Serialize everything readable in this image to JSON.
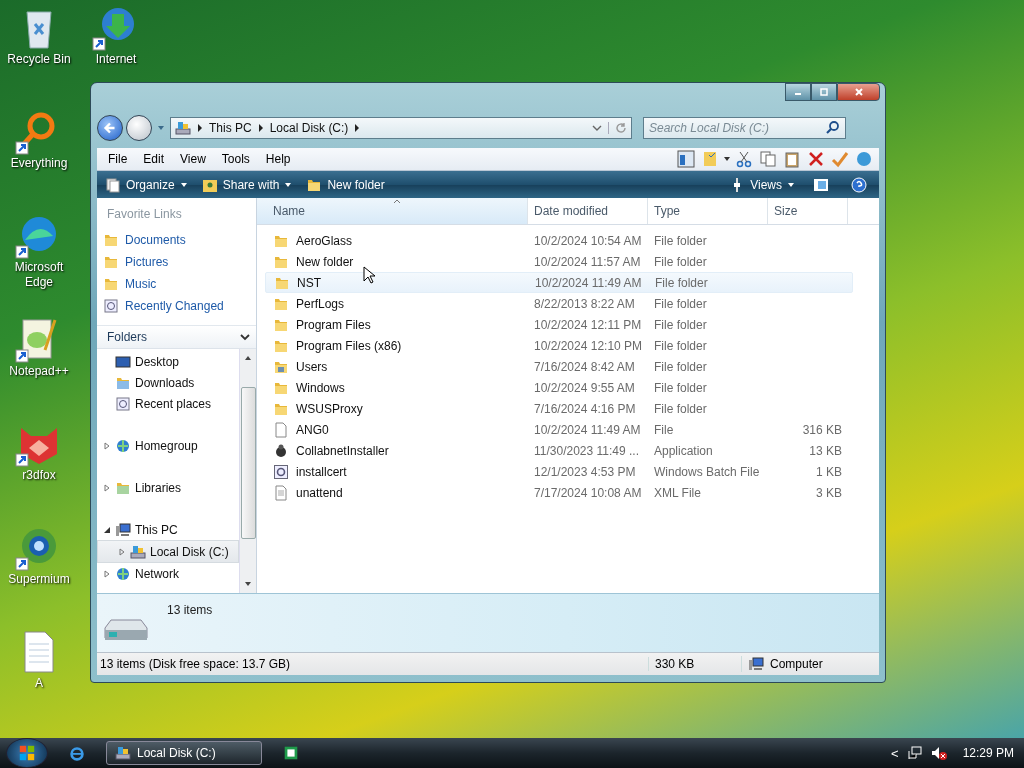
{
  "desktop_icons": [
    {
      "label": "Recycle Bin",
      "kind": "recycle",
      "shortcut": false
    },
    {
      "label": "Everything",
      "kind": "search-ring",
      "shortcut": true
    },
    {
      "label": "Microsoft Edge",
      "kind": "edge",
      "shortcut": true
    },
    {
      "label": "Notepad++",
      "kind": "notepad",
      "shortcut": true
    },
    {
      "label": "r3dfox",
      "kind": "fox",
      "shortcut": true
    },
    {
      "label": "Supermium",
      "kind": "globe",
      "shortcut": true
    },
    {
      "label": "A",
      "kind": "document",
      "shortcut": false
    }
  ],
  "desktop_icons_right": [
    {
      "label": "Internet",
      "kind": "globe-arrow",
      "shortcut": true
    }
  ],
  "window": {
    "breadcrumbs": [
      "This PC",
      "Local Disk (C:)"
    ],
    "search": {
      "placeholder": "Search Local Disk (C:)"
    },
    "menu": [
      "File",
      "Edit",
      "View",
      "Tools",
      "Help"
    ],
    "commands": [
      {
        "label": "Organize",
        "kind": "organize",
        "dropdown": true
      },
      {
        "label": "Share with",
        "kind": "share",
        "dropdown": true
      },
      {
        "label": "New folder",
        "kind": "folder",
        "dropdown": false
      }
    ],
    "views_label": "Views",
    "favorites": {
      "title": "Favorite Links",
      "items": [
        {
          "label": "Documents",
          "kind": "documents"
        },
        {
          "label": "Pictures",
          "kind": "pictures"
        },
        {
          "label": "Music",
          "kind": "music"
        },
        {
          "label": "Recently Changed",
          "kind": "recent"
        }
      ]
    },
    "folders": {
      "title": "Folders",
      "tree": [
        {
          "label": "Desktop",
          "kind": "desktop",
          "expandable": false,
          "selected": false
        },
        {
          "label": "Downloads",
          "kind": "downloads",
          "expandable": false,
          "selected": false
        },
        {
          "label": "Recent places",
          "kind": "recent",
          "expandable": false,
          "selected": false
        },
        {
          "label": "Homegroup",
          "kind": "homegroup",
          "expandable": true,
          "expanded": false,
          "selected": false
        },
        {
          "label": "Libraries",
          "kind": "libraries",
          "expandable": true,
          "expanded": false,
          "selected": false
        },
        {
          "label": "This PC",
          "kind": "pc",
          "expandable": true,
          "expanded": true,
          "selected": false,
          "children": [
            {
              "label": "Local Disk (C:)",
              "kind": "drive",
              "expandable": true,
              "expanded": false,
              "selected": true
            }
          ]
        },
        {
          "label": "Network",
          "kind": "network",
          "expandable": true,
          "expanded": false,
          "selected": false
        }
      ]
    },
    "columns": [
      {
        "label": "Name",
        "sorted": true
      },
      {
        "label": "Date modified",
        "sorted": false
      },
      {
        "label": "Type",
        "sorted": false
      },
      {
        "label": "Size",
        "sorted": false
      }
    ],
    "rows": [
      {
        "name": "AeroGlass",
        "date": "10/2/2024 10:54 AM",
        "type": "File folder",
        "size": "",
        "kind": "folder",
        "hovered": false
      },
      {
        "name": "New folder",
        "date": "10/2/2024 11:57 AM",
        "type": "File folder",
        "size": "",
        "kind": "folder",
        "hovered": false
      },
      {
        "name": "NST",
        "date": "10/2/2024 11:49 AM",
        "type": "File folder",
        "size": "",
        "kind": "folder",
        "hovered": true
      },
      {
        "name": "PerfLogs",
        "date": "8/22/2013 8:22 AM",
        "type": "File folder",
        "size": "",
        "kind": "folder",
        "hovered": false
      },
      {
        "name": "Program Files",
        "date": "10/2/2024 12:11 PM",
        "type": "File folder",
        "size": "",
        "kind": "folder",
        "hovered": false
      },
      {
        "name": "Program Files (x86)",
        "date": "10/2/2024 12:10 PM",
        "type": "File folder",
        "size": "",
        "kind": "folder",
        "hovered": false
      },
      {
        "name": "Users",
        "date": "7/16/2024 8:42 AM",
        "type": "File folder",
        "size": "",
        "kind": "users",
        "hovered": false
      },
      {
        "name": "Windows",
        "date": "10/2/2024 9:55 AM",
        "type": "File folder",
        "size": "",
        "kind": "folder",
        "hovered": false
      },
      {
        "name": "WSUSProxy",
        "date": "7/16/2024 4:16 PM",
        "type": "File folder",
        "size": "",
        "kind": "folder",
        "hovered": false
      },
      {
        "name": "ANG0",
        "date": "10/2/2024 11:49 AM",
        "type": "File",
        "size": "316 KB",
        "kind": "file",
        "hovered": false
      },
      {
        "name": "CollabnetInstaller",
        "date": "11/30/2023 11:49 ...",
        "type": "Application",
        "size": "13 KB",
        "kind": "app",
        "hovered": false
      },
      {
        "name": "installcert",
        "date": "12/1/2023 4:53 PM",
        "type": "Windows Batch File",
        "size": "1 KB",
        "kind": "batch",
        "hovered": false
      },
      {
        "name": "unattend",
        "date": "7/17/2024 10:08 AM",
        "type": "XML File",
        "size": "3 KB",
        "kind": "xml",
        "hovered": false
      }
    ],
    "details": {
      "count": "13 items"
    },
    "status": {
      "summary": "13 items (Disk free space: 13.7 GB)",
      "size": "330 KB",
      "zone": "Computer"
    }
  },
  "taskbar": {
    "tasks": [
      {
        "label": "Local Disk (C:)",
        "selected": true
      }
    ],
    "tray_arrow": "<",
    "clock": "12:29 PM",
    "volume_muted": true
  }
}
